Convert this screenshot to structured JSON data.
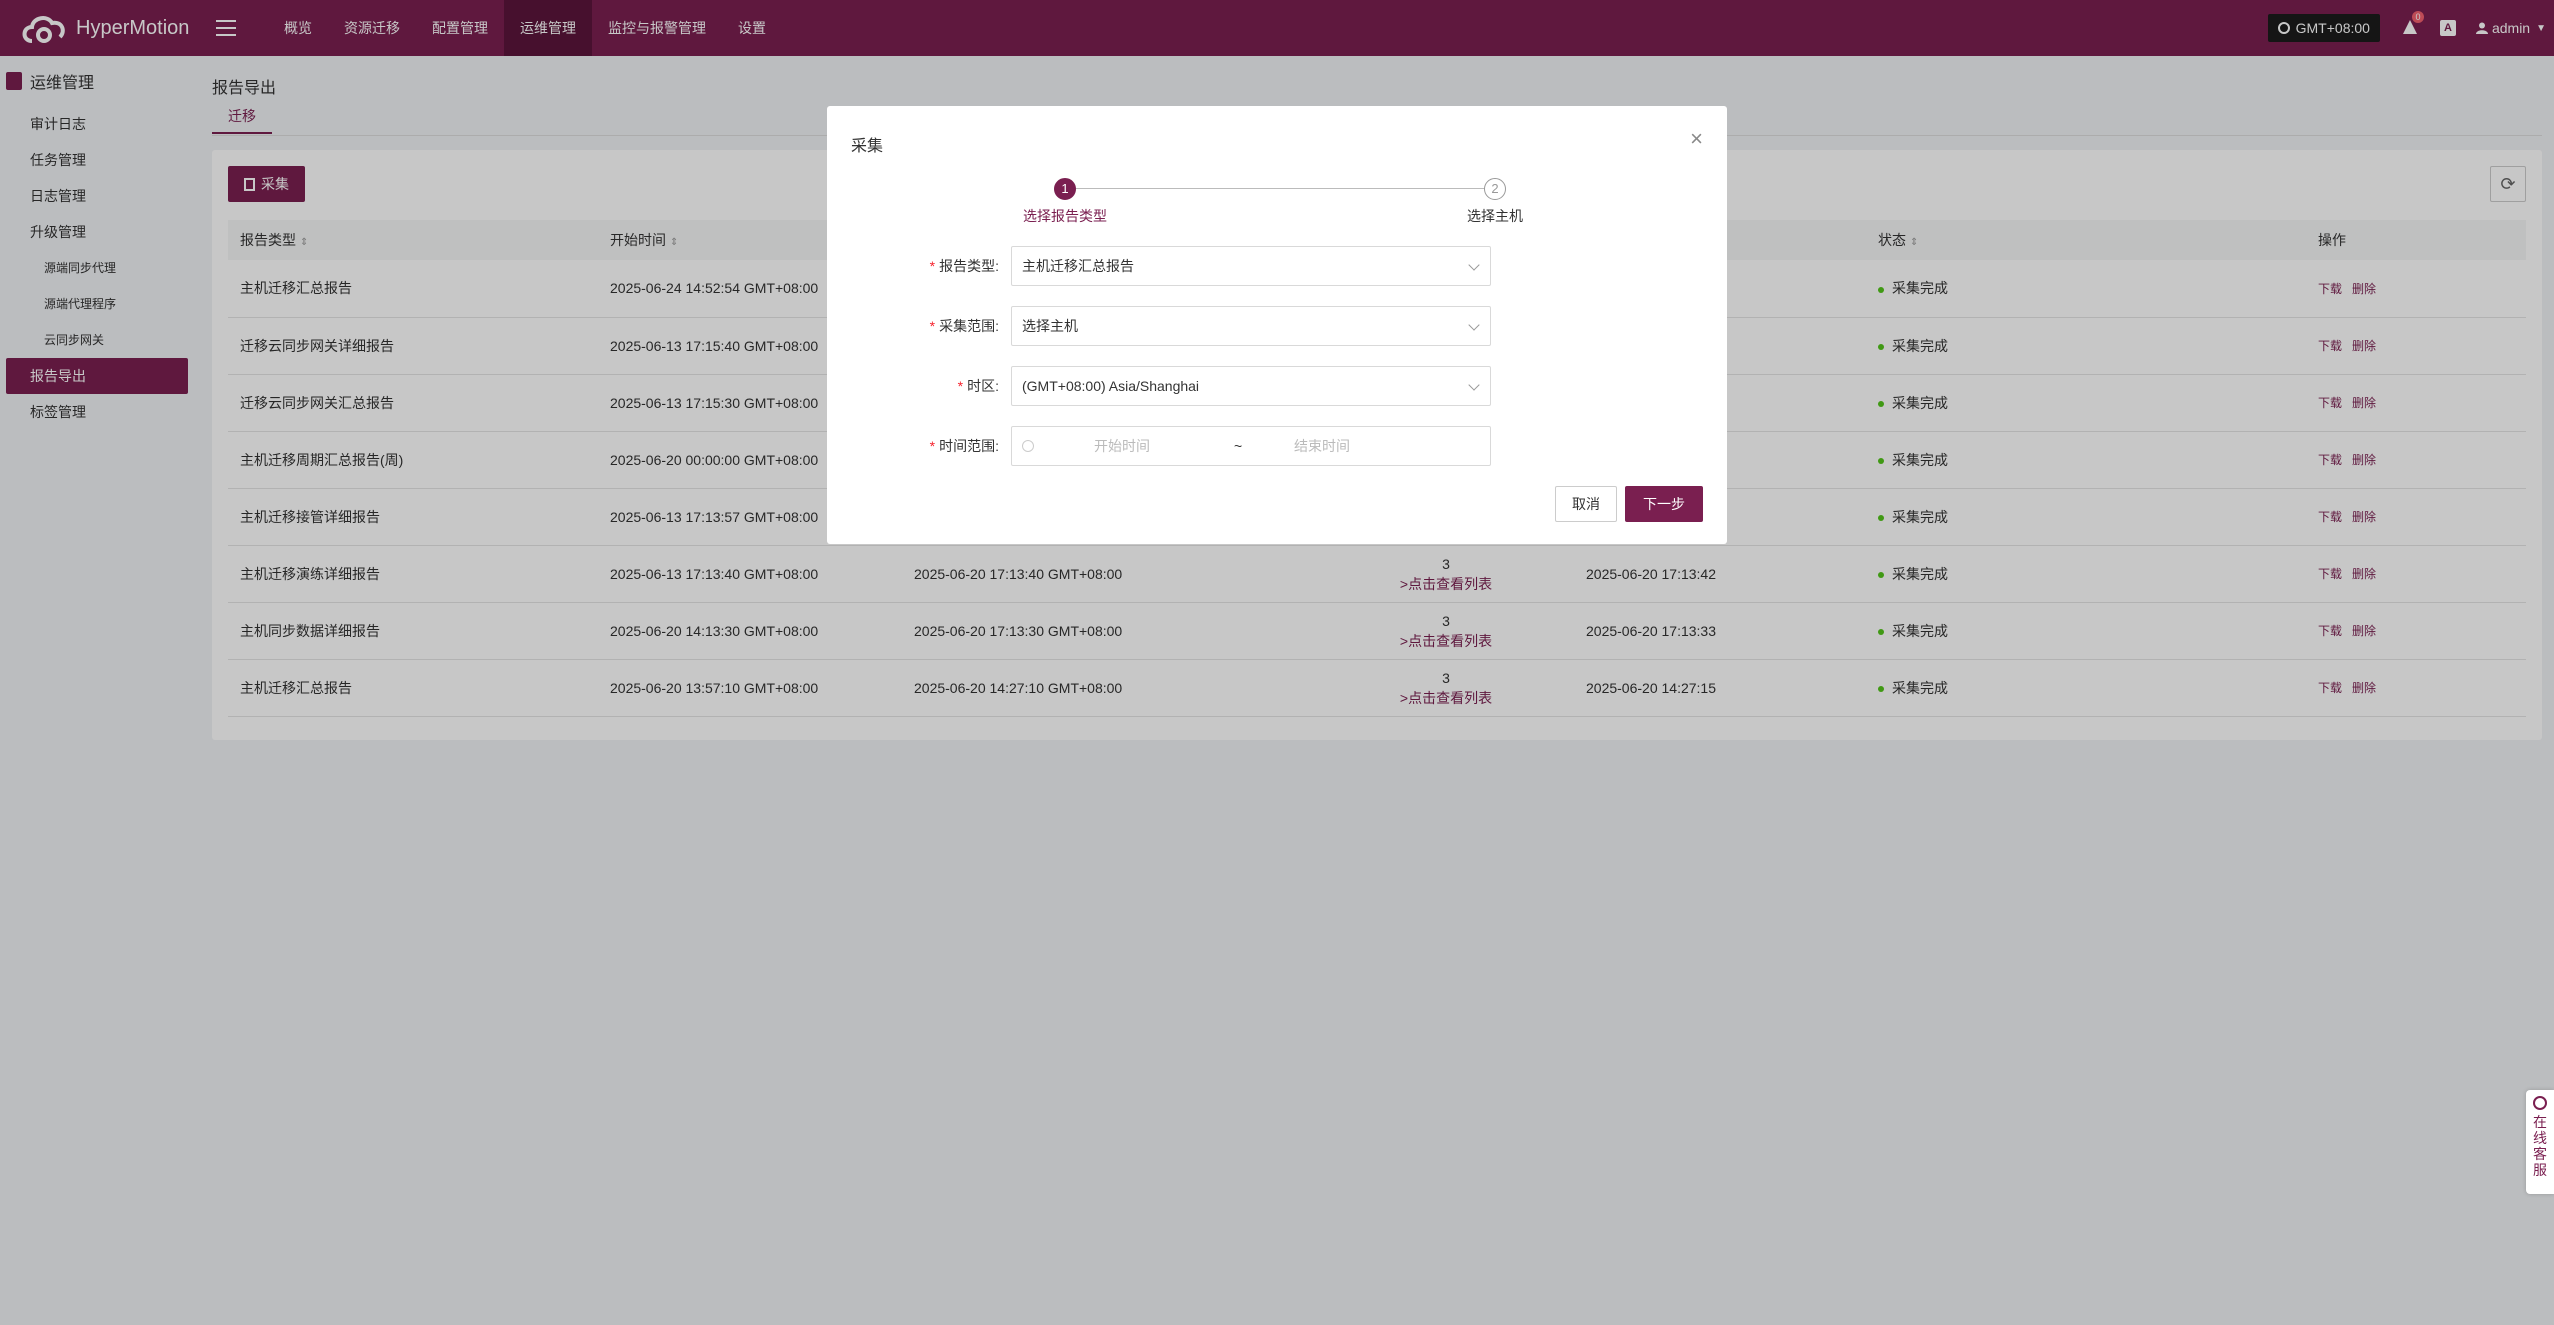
{
  "app": {
    "name": "HyperMotion"
  },
  "nav": [
    "概览",
    "资源迁移",
    "配置管理",
    "运维管理",
    "监控与报警管理",
    "设置"
  ],
  "topright": {
    "timezone": "GMT+08:00",
    "notif_count": "0",
    "lang": "A",
    "user": "admin"
  },
  "sidebar": {
    "title": "运维管理",
    "items": [
      "审计日志",
      "任务管理",
      "日志管理",
      "升级管理",
      "源端同步代理",
      "源端代理程序",
      "云同步网关",
      "报告导出",
      "标签管理"
    ]
  },
  "page": {
    "title": "报告导出",
    "tab": "迁移",
    "collect_button": "采集"
  },
  "table": {
    "headers": [
      "报告类型",
      "开始时间",
      "",
      "",
      "",
      "状态",
      "操作"
    ],
    "rows": [
      {
        "type": "主机迁移汇总报告",
        "start": "2025-06-24 14:52:54 GMT+08:00",
        "end": "",
        "count": "",
        "link": "",
        "finish": "",
        "status": "采集完成"
      },
      {
        "type": "迁移云同步网关详细报告",
        "start": "2025-06-13 17:15:40 GMT+08:00",
        "end": "",
        "count": "",
        "link": "",
        "finish": "",
        "status": "采集完成"
      },
      {
        "type": "迁移云同步网关汇总报告",
        "start": "2025-06-13 17:15:30 GMT+08:00",
        "end": "",
        "count": "",
        "link": "",
        "finish": "",
        "status": "采集完成"
      },
      {
        "type": "主机迁移周期汇总报告(周)",
        "start": "2025-06-20 00:00:00 GMT+08:00",
        "end": "",
        "count": "",
        "link": "",
        "finish": "",
        "status": "采集完成"
      },
      {
        "type": "主机迁移接管详细报告",
        "start": "2025-06-13 17:13:57 GMT+08:00",
        "end": "",
        "count": "",
        "link": "",
        "finish": "",
        "status": "采集完成"
      },
      {
        "type": "主机迁移演练详细报告",
        "start": "2025-06-13 17:13:40 GMT+08:00",
        "end": "2025-06-20 17:13:40 GMT+08:00",
        "count": "3",
        "link": ">点击查看列表",
        "finish": "2025-06-20 17:13:42",
        "status": "采集完成"
      },
      {
        "type": "主机同步数据详细报告",
        "start": "2025-06-20 14:13:30 GMT+08:00",
        "end": "2025-06-20 17:13:30 GMT+08:00",
        "count": "3",
        "link": ">点击查看列表",
        "finish": "2025-06-20 17:13:33",
        "status": "采集完成"
      },
      {
        "type": "主机迁移汇总报告",
        "start": "2025-06-20 13:57:10 GMT+08:00",
        "end": "2025-06-20 14:27:10 GMT+08:00",
        "count": "3",
        "link": ">点击查看列表",
        "finish": "2025-06-20 14:27:15",
        "status": "采集完成"
      }
    ],
    "op_download": "下载",
    "op_delete": "删除"
  },
  "modal": {
    "title": "采集",
    "steps": [
      {
        "num": "1",
        "label": "选择报告类型"
      },
      {
        "num": "2",
        "label": "选择主机"
      }
    ],
    "fields": {
      "report_type": {
        "label": "报告类型:",
        "value": "主机迁移汇总报告"
      },
      "scope": {
        "label": "采集范围:",
        "value": "选择主机"
      },
      "timezone": {
        "label": "时区:",
        "value": "(GMT+08:00) Asia/Shanghai"
      },
      "time_range": {
        "label": "时间范围:",
        "start_placeholder": "开始时间",
        "separator": "~",
        "end_placeholder": "结束时间"
      }
    },
    "cancel": "取消",
    "next": "下一步"
  },
  "float_service": "在线客服",
  "colors": {
    "brand": "#7a1f50",
    "status_ok": "#52c41a"
  }
}
